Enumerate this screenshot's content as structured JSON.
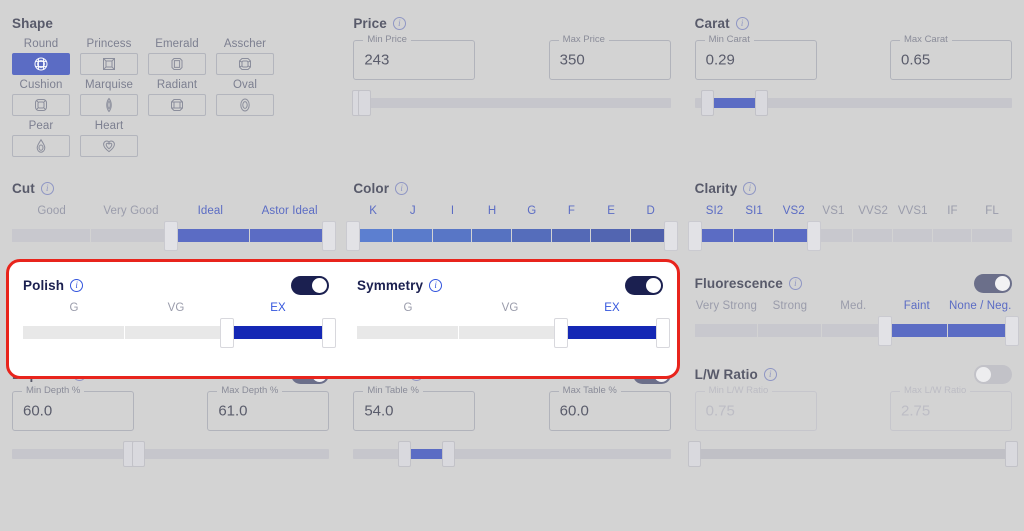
{
  "shape": {
    "title": "Shape",
    "options": [
      {
        "label": "Round",
        "icon": "round-diamond-icon",
        "selected": true
      },
      {
        "label": "Princess",
        "icon": "princess-diamond-icon",
        "selected": false
      },
      {
        "label": "Emerald",
        "icon": "emerald-diamond-icon",
        "selected": false
      },
      {
        "label": "Asscher",
        "icon": "asscher-diamond-icon",
        "selected": false
      },
      {
        "label": "Cushion",
        "icon": "cushion-diamond-icon",
        "selected": false
      },
      {
        "label": "Marquise",
        "icon": "marquise-diamond-icon",
        "selected": false
      },
      {
        "label": "Radiant",
        "icon": "radiant-diamond-icon",
        "selected": false
      },
      {
        "label": "Oval",
        "icon": "oval-diamond-icon",
        "selected": false
      },
      {
        "label": "Pear",
        "icon": "pear-diamond-icon",
        "selected": false
      },
      {
        "label": "Heart",
        "icon": "heart-diamond-icon",
        "selected": false
      }
    ]
  },
  "price": {
    "title": "Price",
    "info_icon": "info-icon",
    "min_label": "Min Price",
    "min_value": "243",
    "max_label": "Max Price",
    "max_value": "350",
    "slider": {
      "start_pct": 1.5,
      "end_pct": 3.5
    }
  },
  "carat": {
    "title": "Carat",
    "info_icon": "info-icon",
    "min_label": "Min Carat",
    "min_value": "0.29",
    "max_label": "Max Carat",
    "max_value": "0.65",
    "slider": {
      "start_pct": 4.0,
      "end_pct": 21.0
    }
  },
  "cut": {
    "title": "Cut",
    "info_icon": "info-icon",
    "steps": [
      {
        "label": "Good",
        "active": false
      },
      {
        "label": "Very Good",
        "active": false
      },
      {
        "label": "Ideal",
        "active": true
      },
      {
        "label": "Astor Ideal",
        "active": true
      }
    ]
  },
  "color": {
    "title": "Color",
    "info_icon": "info-icon",
    "steps": [
      {
        "label": "K",
        "active": true,
        "color": "#5c7fd0"
      },
      {
        "label": "J",
        "active": true,
        "color": "#5a7bcb"
      },
      {
        "label": "I",
        "active": true,
        "color": "#5876c6"
      },
      {
        "label": "H",
        "active": true,
        "color": "#5672c1"
      },
      {
        "label": "G",
        "active": true,
        "color": "#556dbb"
      },
      {
        "label": "F",
        "active": true,
        "color": "#5469b6"
      },
      {
        "label": "E",
        "active": true,
        "color": "#5265b1"
      },
      {
        "label": "D",
        "active": true,
        "color": "#5061ac"
      }
    ]
  },
  "clarity": {
    "title": "Clarity",
    "info_icon": "info-icon",
    "steps": [
      {
        "label": "SI2",
        "active": true
      },
      {
        "label": "SI1",
        "active": true
      },
      {
        "label": "VS2",
        "active": true
      },
      {
        "label": "VS1",
        "active": false
      },
      {
        "label": "VVS2",
        "active": false
      },
      {
        "label": "VVS1",
        "active": false
      },
      {
        "label": "IF",
        "active": false
      },
      {
        "label": "FL",
        "active": false
      }
    ]
  },
  "polish": {
    "title": "Polish",
    "info_icon": "info-icon",
    "toggle": {
      "name": "polish-toggle",
      "on": true
    },
    "steps": [
      {
        "label": "G",
        "active": false
      },
      {
        "label": "VG",
        "active": false
      },
      {
        "label": "EX",
        "active": true
      }
    ]
  },
  "symmetry": {
    "title": "Symmetry",
    "info_icon": "info-icon",
    "toggle": {
      "name": "symmetry-toggle",
      "on": true
    },
    "steps": [
      {
        "label": "G",
        "active": false
      },
      {
        "label": "VG",
        "active": false
      },
      {
        "label": "EX",
        "active": true
      }
    ]
  },
  "fluorescence": {
    "title": "Fluorescence",
    "info_icon": "info-icon",
    "toggle": {
      "name": "fluorescence-toggle",
      "on": true
    },
    "steps": [
      {
        "label": "Very Strong",
        "active": false
      },
      {
        "label": "Strong",
        "active": false
      },
      {
        "label": "Med.",
        "active": false
      },
      {
        "label": "Faint",
        "active": true
      },
      {
        "label": "None / Neg.",
        "active": true
      }
    ]
  },
  "depth": {
    "title": "Depth %",
    "info_icon": "info-icon",
    "toggle": {
      "name": "depth-toggle",
      "on": true
    },
    "min_label": "Min Depth %",
    "min_value": "60.0",
    "max_label": "Max Depth %",
    "max_value": "61.0",
    "slider": {
      "start_pct": 37.0,
      "end_pct": 40.0
    }
  },
  "table": {
    "title": "Table %",
    "info_icon": "info-icon",
    "toggle": {
      "name": "table-toggle",
      "on": true
    },
    "min_label": "Min Table %",
    "min_value": "54.0",
    "max_label": "Max Table %",
    "max_value": "60.0",
    "slider": {
      "start_pct": 16.0,
      "end_pct": 30.0
    }
  },
  "lw_ratio": {
    "title": "L/W Ratio",
    "info_icon": "info-icon",
    "toggle": {
      "name": "lw-ratio-toggle",
      "on": false
    },
    "disabled": true,
    "min_label": "Min L/W Ratio",
    "min_value": "0.75",
    "max_label": "Max L/W Ratio",
    "max_value": "2.75",
    "slider": {
      "start_pct": 0.0,
      "end_pct": 100.0
    }
  },
  "colors": {
    "page_background": "#d3d3d3",
    "accent_blue": "#5b6cc4",
    "highlight_border": "#e8241c",
    "highlight_background": "#ffffff",
    "active_deep_blue": "#1528b5",
    "toggle_on": "#6b6f8a",
    "toggle_on_highlight": "#1b2050"
  }
}
